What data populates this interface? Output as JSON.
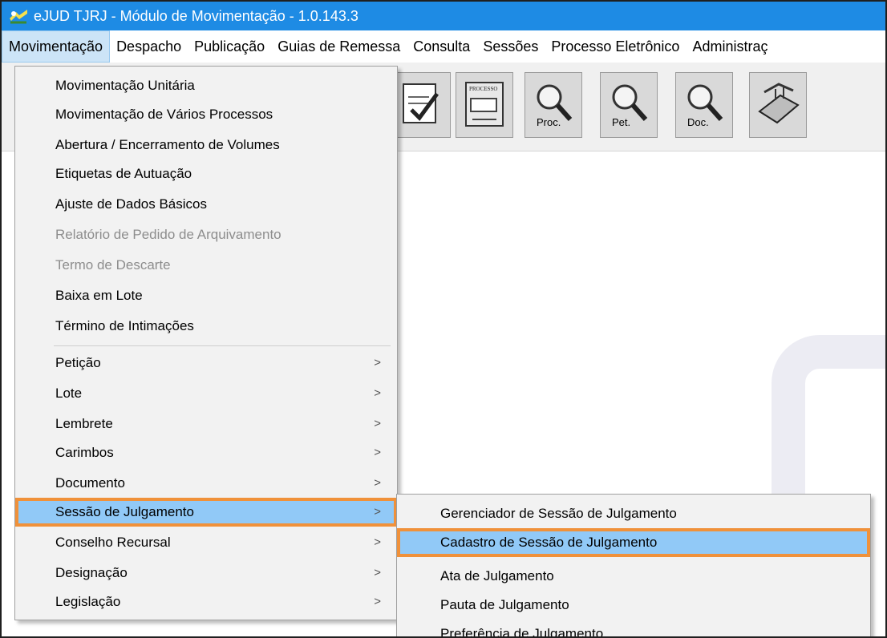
{
  "window": {
    "title": "eJUD TJRJ - Módulo de Movimentação - 1.0.143.3"
  },
  "menubar": {
    "items": [
      {
        "label": "Movimentação",
        "active": true
      },
      {
        "label": "Despacho"
      },
      {
        "label": "Publicação"
      },
      {
        "label": "Guias de Remessa"
      },
      {
        "label": "Consulta"
      },
      {
        "label": "Sessões"
      },
      {
        "label": "Processo Eletrônico"
      },
      {
        "label": "Administraç"
      }
    ]
  },
  "toolbar": {
    "buttons": [
      {
        "icon": "edit-document-icon"
      },
      {
        "icon": "processo-icon",
        "label": "PROCESSO"
      },
      {
        "icon": "search-icon",
        "label": "Proc."
      },
      {
        "icon": "search-icon",
        "label": "Pet."
      },
      {
        "icon": "search-icon",
        "label": "Doc."
      },
      {
        "icon": "scanner-icon"
      }
    ]
  },
  "dropdown": {
    "group1": [
      {
        "label": "Movimentação Unitária"
      },
      {
        "label": "Movimentação de Vários Processos"
      },
      {
        "label": "Abertura / Encerramento de Volumes"
      },
      {
        "label": "Etiquetas de Autuação"
      },
      {
        "label": "Ajuste de Dados Básicos"
      },
      {
        "label": "Relatório de Pedido de Arquivamento",
        "disabled": true
      },
      {
        "label": "Termo de Descarte",
        "disabled": true
      },
      {
        "label": "Baixa em Lote"
      },
      {
        "label": "Término de Intimações"
      }
    ],
    "group2": [
      {
        "label": "Petição",
        "arrow": ">"
      },
      {
        "label": "Lote",
        "arrow": ">"
      },
      {
        "label": "Lembrete",
        "arrow": ">"
      },
      {
        "label": "Carimbos",
        "arrow": ">"
      },
      {
        "label": "Documento",
        "arrow": ">"
      },
      {
        "label": "Sessão de Julgamento",
        "arrow": ">",
        "highlight": true
      },
      {
        "label": "Conselho Recursal",
        "arrow": ">"
      },
      {
        "label": "Designação",
        "arrow": ">"
      },
      {
        "label": "Legislação",
        "arrow": ">"
      }
    ]
  },
  "submenu": {
    "items": [
      {
        "label": "Gerenciador de Sessão de Julgamento"
      },
      {
        "label": "Cadastro de Sessão de Julgamento",
        "highlight": true
      },
      {
        "label": "Ata de Julgamento"
      },
      {
        "label": "Pauta de Julgamento"
      },
      {
        "label": "Preferência de Julgamento"
      }
    ]
  },
  "colors": {
    "titlebar": "#1e8be4",
    "highlight": "#91c9f7",
    "highlight_border": "#f0913a"
  }
}
